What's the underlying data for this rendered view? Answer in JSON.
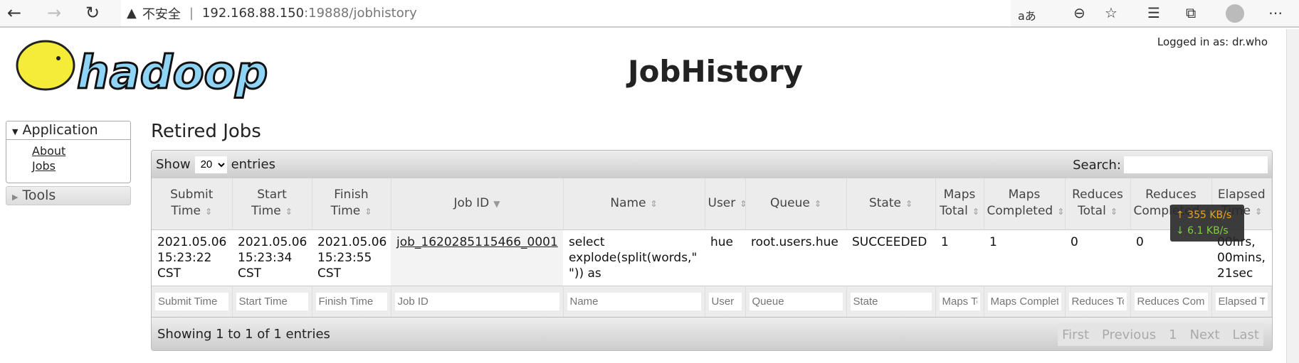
{
  "browser": {
    "url_host": "192.168.88.150",
    "url_rest": ":19888/jobhistory",
    "security": "不安全",
    "reader_icon": "aあ"
  },
  "header": {
    "title": "JobHistory",
    "logged_in": "Logged in as: dr.who",
    "logo_text": "hadoop"
  },
  "sidebar": {
    "application": "Application",
    "items": [
      {
        "label": "About"
      },
      {
        "label": "Jobs"
      }
    ],
    "tools": "Tools"
  },
  "main": {
    "heading": "Retired Jobs",
    "show": "Show",
    "entries_value": "20",
    "entries": "entries",
    "search_label": "Search:",
    "columns": [
      "Submit Time",
      "Start Time",
      "Finish Time",
      "Job ID",
      "Name",
      "User",
      "Queue",
      "State",
      "Maps Total",
      "Maps Completed",
      "Reduces Total",
      "Reduces Completed",
      "Elapsed Time"
    ],
    "rows": [
      [
        "2021.05.06 15:23:22 CST",
        "2021.05.06 15:23:34 CST",
        "2021.05.06 15:23:55 CST",
        "job_1620285115466_0001",
        "select explode(split(words,\" \")) as",
        "hue",
        "root.users.hue",
        "SUCCEEDED",
        "1",
        "1",
        "0",
        "0",
        "00hrs, 00mins, 21sec"
      ]
    ],
    "filters": [
      "Submit Time",
      "Start Time",
      "Finish Time",
      "Job ID",
      "Name",
      "User",
      "Queue",
      "State",
      "Maps Total",
      "Maps Completed",
      "Reduces Total",
      "Reduces Completed",
      "Elapsed Time"
    ],
    "info": "Showing 1 to 1 of 1 entries",
    "pager": [
      "First",
      "Previous",
      "1",
      "Next",
      "Last"
    ]
  },
  "overlay": {
    "up": "↑ 355 KB/s",
    "down": "↓ 6.1 KB/s",
    "up_color": "#f0a020",
    "down_color": "#7fd040"
  }
}
